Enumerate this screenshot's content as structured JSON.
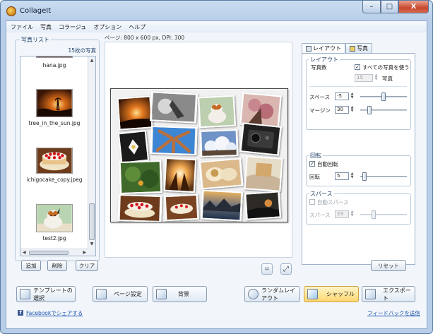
{
  "window": {
    "title": "CollageIt",
    "minimize": "–",
    "maximize": "□",
    "close": "X"
  },
  "menu": [
    "ファイル",
    "写真",
    "コラージュ",
    "オプション",
    "ヘルプ"
  ],
  "page_info": "ページ: 800 x 600 px, DPI: 300",
  "photo_list": {
    "title": "写真リスト",
    "count": "15枚の写真",
    "items": [
      "hana.jpg",
      "tree_in_the_sun.jpg",
      "ichigocake_copy.jpeg",
      "test2.jpg"
    ],
    "buttons": {
      "add": "追加",
      "delete": "削除",
      "clear": "クリア"
    }
  },
  "tabs": {
    "layout": "レイアウト",
    "photo": "写真"
  },
  "layout": {
    "group": "レイアウト",
    "photo_count_label": "写真数",
    "use_all_label": "すべての写真を使う",
    "use_all_checked": true,
    "photo_count_value": "15",
    "photo_unit": "写真",
    "space_label": "スペース",
    "space_value": "-5",
    "margin_label": "マージン",
    "margin_value": "30"
  },
  "rotation": {
    "group": "回転",
    "auto_label": "自動回転",
    "auto_checked": true,
    "rotation_label": "回転",
    "rotation_value": "5"
  },
  "spacing": {
    "group": "スパース",
    "auto_label": "自動スパース",
    "auto_checked": false,
    "label": "スパース",
    "value": "23"
  },
  "reset": "リセット",
  "bottom": {
    "template": "テンプレートの選択",
    "page_setup": "ページ設定",
    "background": "背景",
    "random": "ランダムレイアウト",
    "shuffle": "シャッフル",
    "export": "エクスポート"
  },
  "links": {
    "facebook": "Facebookでシェアする",
    "feedback": "フィードバックを送信"
  },
  "colors": {
    "accent": "#1c55b0",
    "shuffle_highlight": "#ffd770"
  }
}
